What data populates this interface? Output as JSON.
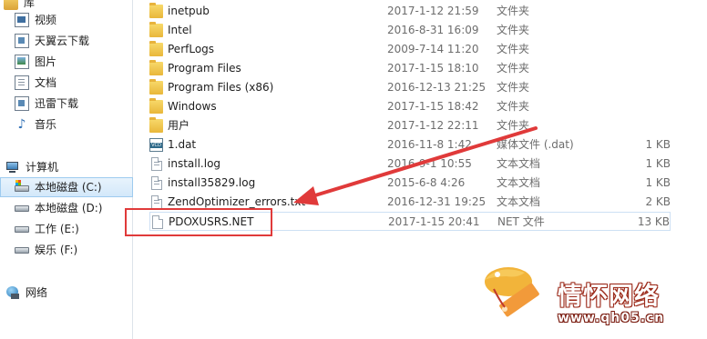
{
  "nav": {
    "items": [
      {
        "label": "库",
        "icon": "library-icon"
      },
      {
        "label": "视频",
        "icon": "video-library-icon"
      },
      {
        "label": "天翼云下载",
        "icon": "download-folder-icon"
      },
      {
        "label": "图片",
        "icon": "pictures-library-icon"
      },
      {
        "label": "文档",
        "icon": "documents-library-icon"
      },
      {
        "label": "迅雷下载",
        "icon": "download-folder-icon"
      },
      {
        "label": "音乐",
        "icon": "music-library-icon"
      },
      {
        "label": "计算机",
        "icon": "computer-icon"
      },
      {
        "label": "本地磁盘 (C:)",
        "icon": "system-drive-icon",
        "selected": true
      },
      {
        "label": "本地磁盘 (D:)",
        "icon": "drive-icon"
      },
      {
        "label": "工作 (E:)",
        "icon": "drive-icon"
      },
      {
        "label": "娱乐 (F:)",
        "icon": "drive-icon"
      },
      {
        "label": "网络",
        "icon": "network-icon"
      }
    ]
  },
  "files": [
    {
      "name": "inetpub",
      "date": "2017-1-12 21:59",
      "type": "文件夹",
      "size": "",
      "icon": "folder-icon"
    },
    {
      "name": "Intel",
      "date": "2016-8-31 16:09",
      "type": "文件夹",
      "size": "",
      "icon": "folder-icon"
    },
    {
      "name": "PerfLogs",
      "date": "2009-7-14 11:20",
      "type": "文件夹",
      "size": "",
      "icon": "folder-icon"
    },
    {
      "name": "Program Files",
      "date": "2017-1-15 18:10",
      "type": "文件夹",
      "size": "",
      "icon": "folder-icon"
    },
    {
      "name": "Program Files (x86)",
      "date": "2016-12-13 21:25",
      "type": "文件夹",
      "size": "",
      "icon": "folder-icon"
    },
    {
      "name": "Windows",
      "date": "2017-1-15 18:42",
      "type": "文件夹",
      "size": "",
      "icon": "folder-icon"
    },
    {
      "name": "用户",
      "date": "2017-1-12 22:11",
      "type": "文件夹",
      "size": "",
      "icon": "folder-icon"
    },
    {
      "name": "1.dat",
      "date": "2016-11-8 1:42",
      "type": "媒体文件 (.dat)",
      "size": "1 KB",
      "icon": "media-file-icon"
    },
    {
      "name": "install.log",
      "date": "2016-9-1 10:55",
      "type": "文本文档",
      "size": "1 KB",
      "icon": "text-file-icon"
    },
    {
      "name": "install35829.log",
      "date": "2015-6-8 4:26",
      "type": "文本文档",
      "size": "1 KB",
      "icon": "text-file-icon"
    },
    {
      "name": "ZendOptimizer_errors.txt",
      "date": "2016-12-31 19:25",
      "type": "文本文档",
      "size": "2 KB",
      "icon": "text-file-icon"
    },
    {
      "name": "PDOXUSRS.NET",
      "date": "2017-1-15 20:41",
      "type": "NET 文件",
      "size": "13 KB",
      "icon": "blank-file-icon",
      "highlighted": true
    }
  ],
  "watermark": {
    "title": "情怀网络",
    "url": "www.qh05.cn"
  },
  "colors": {
    "annotation": "#e03a3a",
    "selection": "#d3e8fa"
  }
}
